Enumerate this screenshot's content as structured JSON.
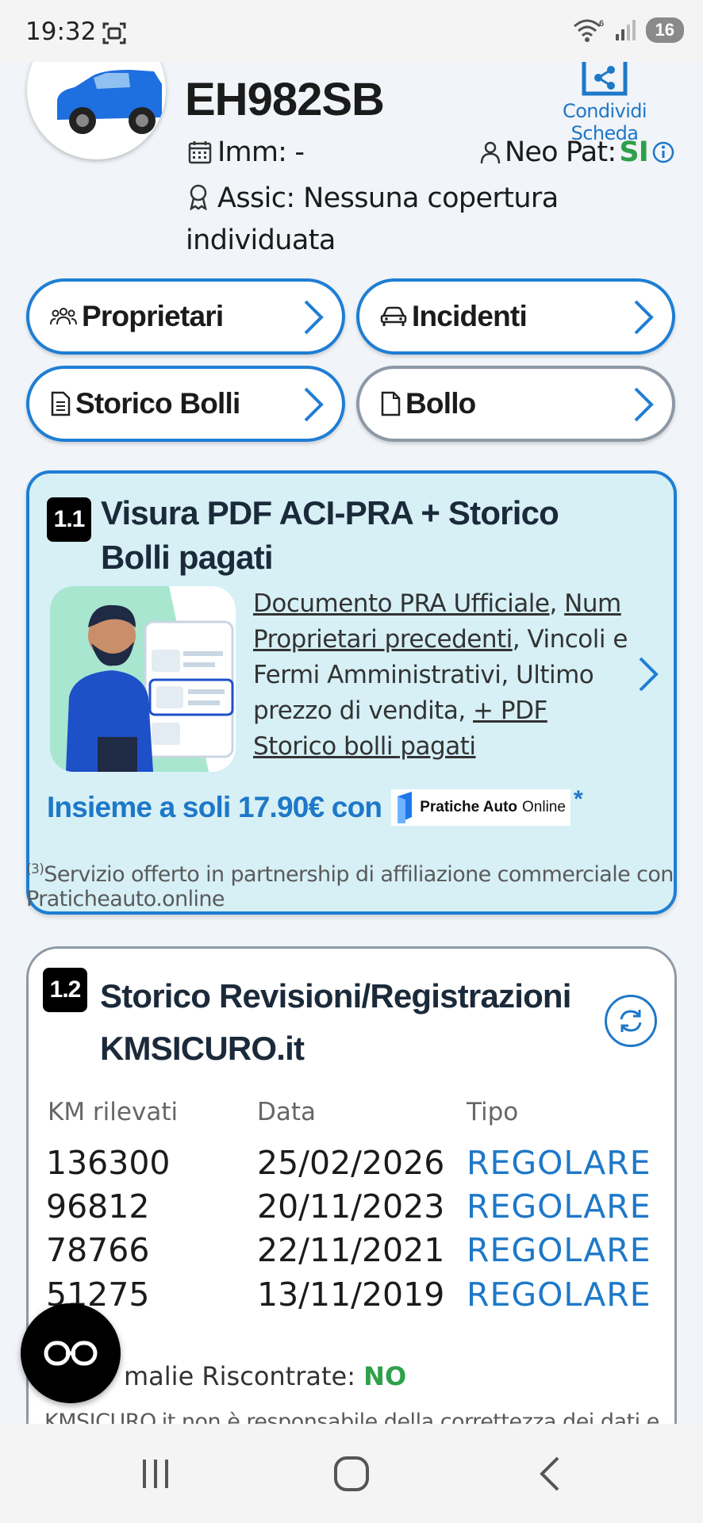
{
  "status_bar": {
    "time": "19:32",
    "battery": "16",
    "wifi_label": "6"
  },
  "header": {
    "plate": "EH982SB",
    "share_label": "Condividi Scheda",
    "imm_label": "Imm: -",
    "neo_label": "Neo Pat: ",
    "neo_value": "SI",
    "assic_label": "Assic: Nessuna copertura individuata"
  },
  "buttons": {
    "proprietari": "Proprietari",
    "incidenti": "Incidenti",
    "storico_bolli": "Storico Bolli",
    "bollo": "Bollo"
  },
  "aci_card": {
    "badge": "1.1",
    "title": "Visura PDF ACI-PRA + Storico Bolli pagati",
    "link_doc": "Documento PRA Ufficiale",
    "sep1": ", ",
    "link_num": "Num Proprietari precedenti",
    "text_mid": ", Vincoli e Fermi Amministrativi, Ultimo prezzo di vendita, ",
    "link_pdf": "+ PDF Storico bolli pagati",
    "promo": "Insieme a soli 17.90€ con",
    "logo_bold": "Pratiche Auto",
    "logo_light": "Online",
    "star": "*"
  },
  "disclaimer": {
    "sup": "(3)",
    "text": "Servizio offerto in partnership di affiliazione commerciale con Praticheauto.online"
  },
  "km_card": {
    "badge": "1.2",
    "title": "Storico Revisioni/Registrazioni KMSICURO.it",
    "columns": [
      "KM rilevati",
      "Data",
      "Tipo"
    ],
    "rows": [
      {
        "km": "136300",
        "data": "25/02/2026",
        "tipo": "REGOLARE"
      },
      {
        "km": "96812",
        "data": "20/11/2023",
        "tipo": "REGOLARE"
      },
      {
        "km": "78766",
        "data": "22/11/2021",
        "tipo": "REGOLARE"
      },
      {
        "km": "51275",
        "data": "13/11/2019",
        "tipo": "REGOLARE"
      }
    ],
    "anomalie_label": "malie Riscontrate: ",
    "anomalie_value": "NO",
    "note": "KMSICURO.it non è responsabile della correttezza dei dati e la base giuridica per il trattamento dei dati è l'esecuzione del"
  },
  "colors": {
    "accent": "#1e7ed4",
    "green": "#2ea04a",
    "card_bg": "#d6f0f6"
  },
  "icons": [
    "screenshot-icon",
    "wifi-icon",
    "signal-icon",
    "battery-icon",
    "share-icon",
    "calendar-icon",
    "person-icon",
    "info-icon",
    "award-icon",
    "group-icon",
    "car-icon",
    "document-icon",
    "chevron-right-icon",
    "refresh-icon",
    "glasses-icon",
    "recents-icon",
    "home-icon",
    "back-icon"
  ]
}
